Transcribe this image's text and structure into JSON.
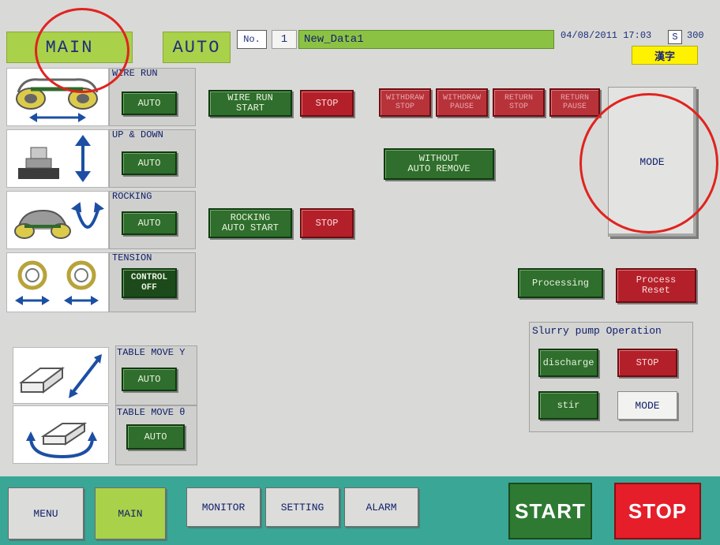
{
  "header": {
    "screen_tab": "MAIN",
    "mode_tab": "AUTO",
    "no_label": "No.",
    "data_number": "1",
    "data_name": "New_Data1",
    "datetime": "04/08/2011 17:03",
    "s_label": "S",
    "s_value": "300",
    "language_button": "漢字"
  },
  "axes": {
    "wire_run": {
      "title": "WIRE RUN",
      "mode": "AUTO",
      "icon": "wire-saw-horizontal-icon"
    },
    "up_down": {
      "title": "UP & DOWN",
      "mode": "AUTO",
      "icon": "table-vertical-icon"
    },
    "rocking": {
      "title": "ROCKING",
      "mode": "AUTO",
      "icon": "rocking-icon"
    },
    "tension": {
      "title": "TENSION",
      "mode": "CONTROL\nOFF",
      "icon": "tension-reels-icon"
    },
    "table_move_y": {
      "title": "TABLE MOVE Y",
      "mode": "AUTO",
      "icon": "table-move-y-icon"
    },
    "table_move_theta": {
      "title": "TABLE MOVE θ",
      "mode": "AUTO",
      "icon": "table-rotate-icon"
    }
  },
  "controls": {
    "wire_run_start": "WIRE RUN\nSTART",
    "wire_run_stop": "STOP",
    "withdraw_stop": "WITHDRAW\nSTOP",
    "withdraw_pause": "WITHDRAW\nPAUSE",
    "return_stop": "RETURN\nSTOP",
    "return_pause": "RETURN\nPAUSE",
    "mode": "MODE",
    "without_auto_remove": "WITHOUT\nAUTO REMOVE",
    "rocking_auto_start": "ROCKING\nAUTO START",
    "rocking_stop": "STOP",
    "processing": "Processing",
    "process_reset": "Process\nReset"
  },
  "slurry": {
    "title": "Slurry pump Operation",
    "discharge": "discharge",
    "stop": "STOP",
    "stir": "stir",
    "mode": "MODE"
  },
  "footer": {
    "menu": "MENU",
    "main": "MAIN",
    "monitor": "MONITOR",
    "setting": "SETTING",
    "alarm": "ALARM",
    "start": "START",
    "stop": "STOP"
  },
  "colors": {
    "accent_green": "#a9d14a",
    "button_green": "#2f6e2c",
    "button_red": "#b4202a",
    "footer_teal": "#3aa695",
    "annotation_red": "#e0231f"
  }
}
